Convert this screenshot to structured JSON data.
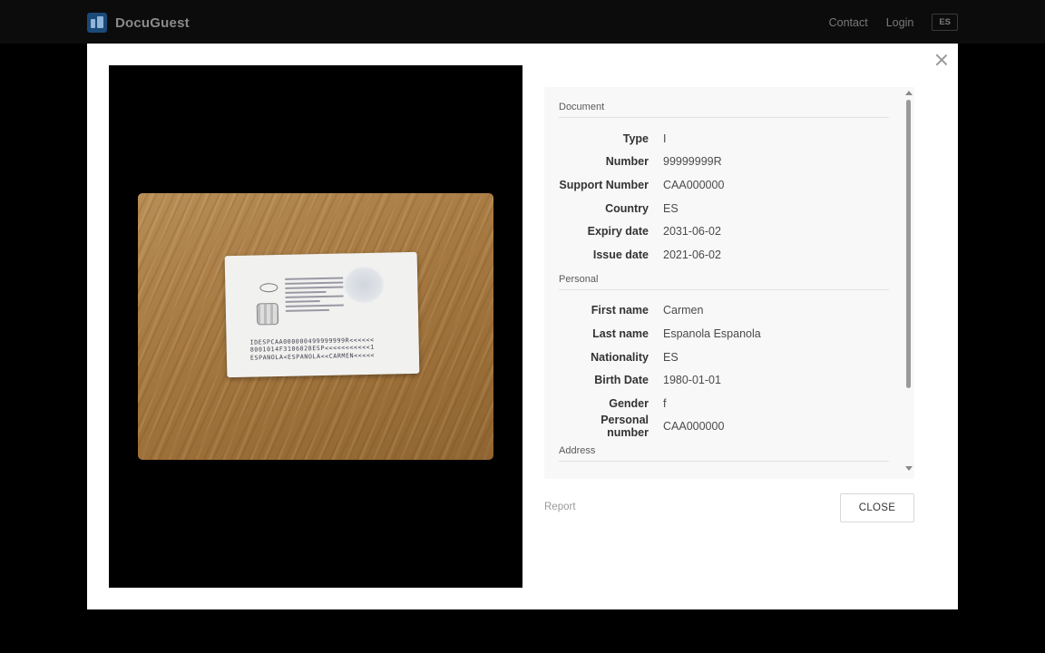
{
  "navbar": {
    "brand_name": "DocuGuest",
    "links": [
      "Contact",
      "Login"
    ],
    "language": "ES"
  },
  "modal": {
    "image": {
      "mrz_lines": [
        "IDESPCAA000000499999999R<<<<<<",
        "8001014F3106028ESP<<<<<<<<<<<1",
        "ESPANOLA<ESPANOLA<<CARMEN<<<<<"
      ]
    },
    "details": {
      "document": {
        "title": "Document",
        "fields": [
          {
            "label": "Type",
            "value": "I"
          },
          {
            "label": "Number",
            "value": "99999999R"
          },
          {
            "label": "Support Number",
            "value": "CAA000000"
          },
          {
            "label": "Country",
            "value": "ES"
          },
          {
            "label": "Expiry date",
            "value": "2031-06-02"
          },
          {
            "label": "Issue date",
            "value": "2021-06-02"
          }
        ]
      },
      "personal": {
        "title": "Personal",
        "fields": [
          {
            "label": "First name",
            "value": "Carmen"
          },
          {
            "label": "Last name",
            "value": "Espanola Espanola"
          },
          {
            "label": "Nationality",
            "value": "ES"
          },
          {
            "label": "Birth Date",
            "value": "1980-01-01"
          },
          {
            "label": "Gender",
            "value": "f"
          },
          {
            "label": "Personal number",
            "value": "CAA000000"
          }
        ]
      },
      "address": {
        "title": "Address"
      }
    },
    "report_label": "Report",
    "close_label": "CLOSE"
  },
  "icons": {
    "brand": "docuguest-logo-icon",
    "close": "close-icon",
    "scroll_up": "scroll-up-arrow-icon",
    "scroll_down": "scroll-down-arrow-icon"
  },
  "colors": {
    "background": "#000000",
    "modal": "#ffffff",
    "panel": "#f8f8f8",
    "brand_logo": "#1b4a78"
  }
}
